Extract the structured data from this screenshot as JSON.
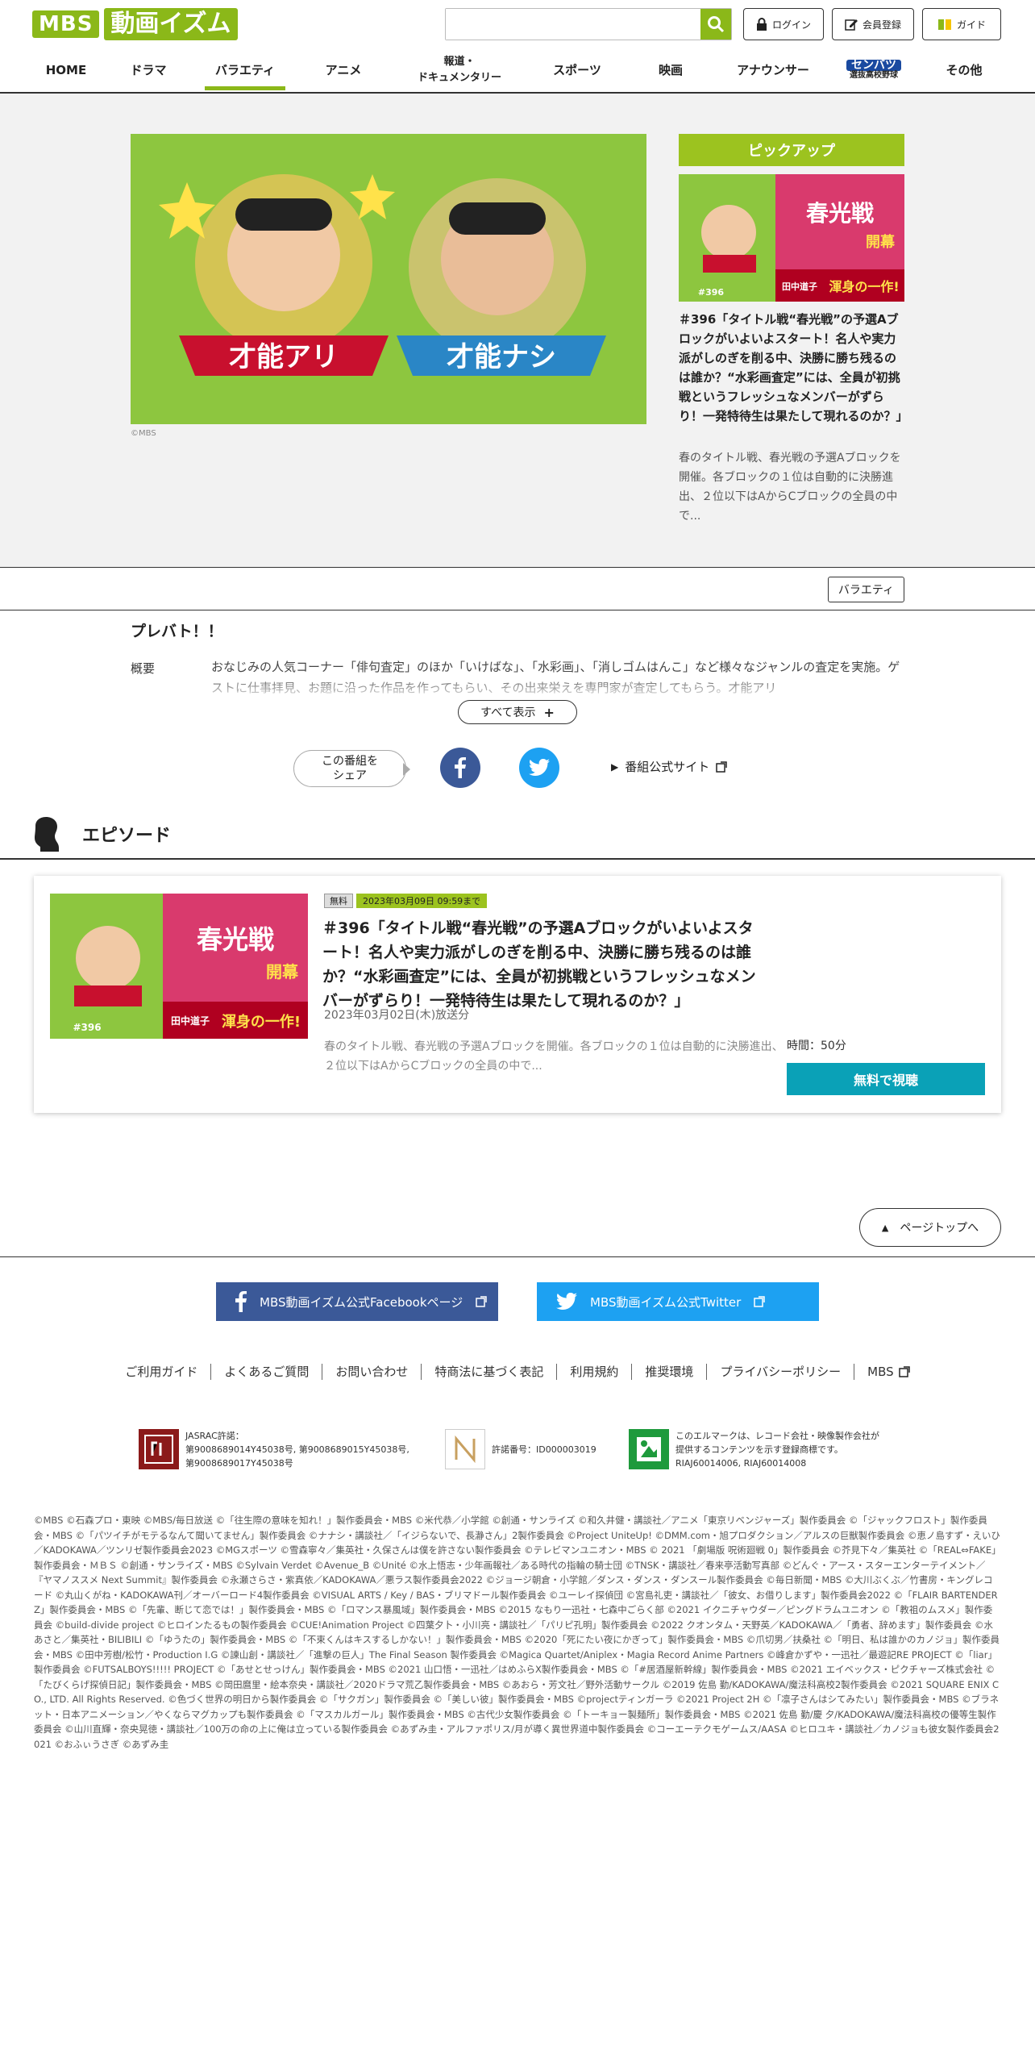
{
  "header": {
    "logo_mbs": "MBS",
    "logo_izumu": "動画イズム",
    "search_placeholder": "",
    "login_label": "ログイン",
    "register_label": "会員登録",
    "guide_label": "ガイド"
  },
  "nav": {
    "items": [
      {
        "label": "HOME"
      },
      {
        "label": "ドラマ"
      },
      {
        "label": "バラエティ"
      },
      {
        "label": "アニメ"
      },
      {
        "label": "報道・\nドキュメンタリー"
      },
      {
        "label": "スポーツ"
      },
      {
        "label": "映画"
      },
      {
        "label": "アナウンサー"
      },
      {
        "label": "センバツ",
        "sub": "選抜高校野球"
      },
      {
        "label": "その他"
      }
    ]
  },
  "hero": {
    "left_badge": "才能アリ",
    "right_badge": "才能ナシ",
    "copyright": "©MBS"
  },
  "pickup": {
    "title": "ピックアップ",
    "thumb_text1": "春光戦",
    "thumb_text2": "開幕",
    "thumb_text3": "田中道子",
    "thumb_text4": "渾身の一作!",
    "thumb_ep": "#396",
    "headline": "＃396「タイトル戦“春光戦”の予選Aブロックがいよいよスタート！名人や実力派がしのぎを削る中、決勝に勝ち残るのは誰か？“水彩画査定”には、全員が初挑戦というフレッシュなメンバーがずらり！一発特待生は果たして現れるのか？」",
    "description": "春のタイトル戦、春光戦の予選Aブロックを開催。各ブロックの１位は自動的に決勝進出、２位以下はAからCブロックの全員の中で..."
  },
  "genre_tag": "バラエティ",
  "program": {
    "title": "プレバト！！",
    "summary_label": "概要",
    "summary": "おなじみの人気コーナー「俳句査定」のほか「いけばな」、「水彩画」、「消しゴムはんこ」など様々なジャンルの査定を実施。ゲストに仕事拝見、お題に沿った作品を作ってもらい、その出来栄えを専門家が査定してもらう。才能アリ",
    "show_all": "すべて表示",
    "share_label": "この番組を\nシェア",
    "official_site": "番組公式サイト"
  },
  "episodes": {
    "section_title": "エピソード",
    "items": [
      {
        "badge_free": "無料",
        "badge_until": "2023年03月09日 09:59まで",
        "title": "＃396「タイトル戦“春光戦”の予選Aブロックがいよいよスタート！名人や実力派がしのぎを削る中、決勝に勝ち残るのは誰か？“水彩画査定”には、全員が初挑戦というフレッシュなメンバーがずらり！一発特待生は果たして現れるのか？」",
        "air_date": "2023年03月02日(木)放送分",
        "description": "春のタイトル戦、春光戦の予選Aブロックを開催。各ブロックの１位は自動的に決勝進出、２位以下はAからCブロックの全員の中で...",
        "duration": "時間：50分",
        "watch_label": "無料で視聴"
      }
    ]
  },
  "pagetop_label": "ページトップへ",
  "social": {
    "facebook_label": "MBS動画イズム公式Facebookページ",
    "twitter_label": "MBS動画イズム公式Twitter"
  },
  "footer_links": [
    "ご利用ガイド",
    "よくあるご質問",
    "お問い合わせ",
    "特商法に基づく表記",
    "利用規約",
    "推奨環境",
    "プライバシーポリシー",
    "MBS"
  ],
  "licenses": {
    "jasrac": "JASRAC許諾：\n第9008689014Y45038号, 第9008689015Y45038号,\n第9008689017Y45038号",
    "nextone": "許諾番号：ID000003019",
    "elmark": "このエルマークは、レコード会社・映像製作会社が\n提供するコンテンツを示す登録商標です。\nRIAJ60014006, RIAJ60014008"
  },
  "copyright_text": "©MBS ©石森プロ・東映 ©MBS/毎日放送 ©「往生際の意味を知れ！」製作委員会・MBS ©米代恭／小学館 ©創通・サンライズ ©和久井健・講談社／アニメ「東京リベンジャーズ」製作委員会 ©「ジャックフロスト」製作委員会・MBS ©「パツイチがモテるなんて聞いてません」製作委員会 ©ナナシ・講談社／「イジらないで、長瀞さん」2製作委員会 ©Project UniteUp! ©DMM.com・旭プロダクション／アルスの巨獣製作委員会 ©恵ノ島すず・えいひ／KADOKAWA／ツンリゼ製作委員会2023 ©MGスポーツ ©雪森寧々／集英社・久保さんは僕を許さない製作委員会 ©テレビマンユニオン・MBS © 2021 「劇場版 呪術廻戦 0」製作委員会 ©芥見下々／集英社 ©「REAL⇔FAKE」製作委員会・ＭＢＳ ©創通・サンライズ・MBS ©Sylvain Verdet ©Avenue_B ©Unité ©水上悟志・少年画報社／ある時代の指輪の騎士団 ©TNSK・講談社／春来亭活動写真部 ©どんぐ・アース・スターエンターテイメント／『ヤマノススメ Next Summit』製作委員会 ©永瀬さらさ・紫真依／KADOKAWA／悪ラス製作委員会2022 ©ジョージ朝倉・小学館／ダンス・ダンス・ダンスール製作委員会 ©毎日新聞・MBS ©大川ぶくぶ／竹書房・キングレコード ©丸山くがね・KADOKAWA刊／オーバーロード4製作委員会 ©VISUAL ARTS / Key / BAS・ブリマドール製作委員会 ©ユーレイ探偵団 ©宮島礼吏・講談社／「彼女、お借りします」製作委員会2022 ©「FLAIR BARTENDERZ」製作委員会・MBS ©「先輩、断じて恋では！」製作委員会・MBS ©「ロマンス暴風域」製作委員会・MBS ©2015 なもり一迅社・七森中ごらく部 ©2021 イクニチャウダー／ピングドラムユニオン ©「教祖のムスメ」製作委員会 ©build-divide project ©ヒロインたるもの製作委員会 ©CUE!Animation Project ©四葉夕卜・小川亮・講談社／「パリピ孔明」製作委員会 ©2022 クオンタム・天野英／KADOKAWA／「勇者、辞めます」製作委員会 ©水あさと／集英社・BILIBILI ©「ゆうたの」製作委員会・MBS ©「不束くんはキスするしかない！」製作委員会・MBS ©2020「死にたい夜にかぎって」製作委員会・MBS ©爪切男／扶桑社 ©「明日、私は誰かのカノジョ」製作委員会・MBS ©田中芳樹/松竹・Production I.G ©諫山創・講談社／「進撃の巨人」The Final Season 製作委員会 ©Magica Quartet/Aniplex・Magia Record Anime Partners ©峰倉かずや・一迅社／最遊記RE PROJECT ©「liar」製作委員会 ©FUTSALBOYS!!!!! PROJECT ©「あせとせっけん」製作委員会・MBS ©2021 山口悟・一迅社／はめふらX製作委員会・MBS ©「#居酒屋新幹線」製作委員会・MBS ©2021 エイベックス・ピクチャーズ株式会社 ©「たびくらげ探偵日記」製作委員会・MBS ©岡田麿里・絵本奈央・講談社／2020ドラマ荒乙製作委員会・MBS ©あおら・芳文社／野外活動サークル ©2019 佐島 勤/KADOKAWA/魔法科高校2製作委員会 ©2021 SQUARE ENIX CO., LTD. All Rights Reserved. ©色づく世界の明日から製作委員会 ©「サクガン」製作委員会 ©「美しい彼」製作委員会・MBS ©projectティンガーラ ©2021 Project 2H ©「凛子さんはシてみたい」製作委員会・MBS ©ブラネット・日本アニメーション／やくならマグカップも製作委員会 ©「マスカルガール」製作委員会・MBS ©古代少女製作委員会 ©「トーキョー製麺所」製作委員会・MBS ©2021 佐島 勤/慶 夕/KADOKAWA/魔法科高校の優等生製作委員会 ©山川直輝・奈央晃徳・講談社／100万の命の上に俺は立っている製作委員会 ©あずみ圭・アルファポリス/月が導く異世界道中製作委員会 ©コーエーテクモゲームス/AASA ©ヒロユキ・講談社／カノジョも彼女製作委員会2021 ©おふぃうさぎ ©あずみ圭",
  "colors": {
    "accent": "#8bb819",
    "pickup": "#9cc31f",
    "watch": "#0aa1b7",
    "facebook": "#3b5998",
    "twitter": "#1da1f2"
  }
}
